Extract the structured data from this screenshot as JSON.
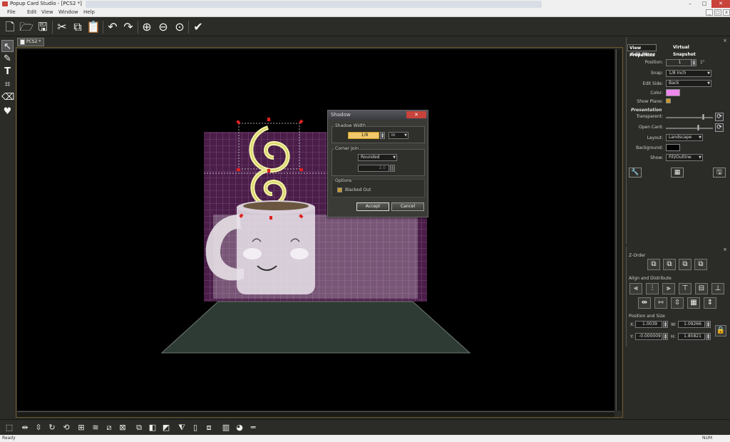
{
  "window": {
    "title": "Popup Card Studio - [PCS2 *]",
    "minimize": "–",
    "maximize": "□",
    "close": "✕"
  },
  "menu": {
    "items": [
      "File",
      "Edit",
      "View",
      "Window",
      "Help"
    ]
  },
  "toolbar": {
    "icons": [
      "new-file-icon",
      "open-folder-icon",
      "save-icon",
      "cut-icon",
      "copy-icon",
      "paste-icon",
      "undo-icon",
      "redo-icon",
      "zoom-in-icon",
      "zoom-out-icon",
      "zoom-fit-icon",
      "checkmark-icon"
    ]
  },
  "doc_tab": {
    "label": "PCS2 *"
  },
  "dialog": {
    "title": "Shadow",
    "close": "✕",
    "shadow_width_label": "Shadow Width",
    "shadow_width_value": "1/8",
    "unit_value": "in",
    "corner_join_label": "Corner Join",
    "corner_join_value": "Rounded",
    "corner_amount_value": "2.0",
    "options_label": "Options",
    "blacked_out_label": "Blacked Out",
    "accept": "Accept",
    "cancel": "Cancel"
  },
  "panel": {
    "tab_view": "View Properties",
    "tab_snapshot": "Virtual Snapshot",
    "edit_plane": "Edit Plane",
    "position_label": "Position:",
    "position_value": "1",
    "position_unit": "1\"",
    "snap_label": "Snap:",
    "snap_value": "1/8 Inch",
    "edit_side_label": "Edit Side:",
    "edit_side_value": "Back",
    "color_label": "Color:",
    "plane_color": "#ee88ee",
    "show_plane_label": "Show Plane:",
    "presentation": "Presentation",
    "transparent_label": "Transparent:",
    "transparent_level": 0.8,
    "open_card_label": "Open Card:",
    "open_card_level": 0.7,
    "layout_label": "Layout:",
    "layout_value": "Landscape",
    "background_label": "Background:",
    "background_color": "#000000",
    "show_label": "Show:",
    "show_value": "Fill/Outline"
  },
  "lower": {
    "zorder": "Z-Order",
    "align": "Align and Distribute",
    "possize": "Position and Size",
    "x_label": "X:",
    "x_value": "1.0039",
    "w_label": "W:",
    "w_value": "1.09266",
    "y_label": "Y:",
    "y_value": "-0.000009",
    "h_label": "H:",
    "h_value": "1.85821"
  },
  "status": {
    "left": "Ready",
    "right": "NUM"
  }
}
